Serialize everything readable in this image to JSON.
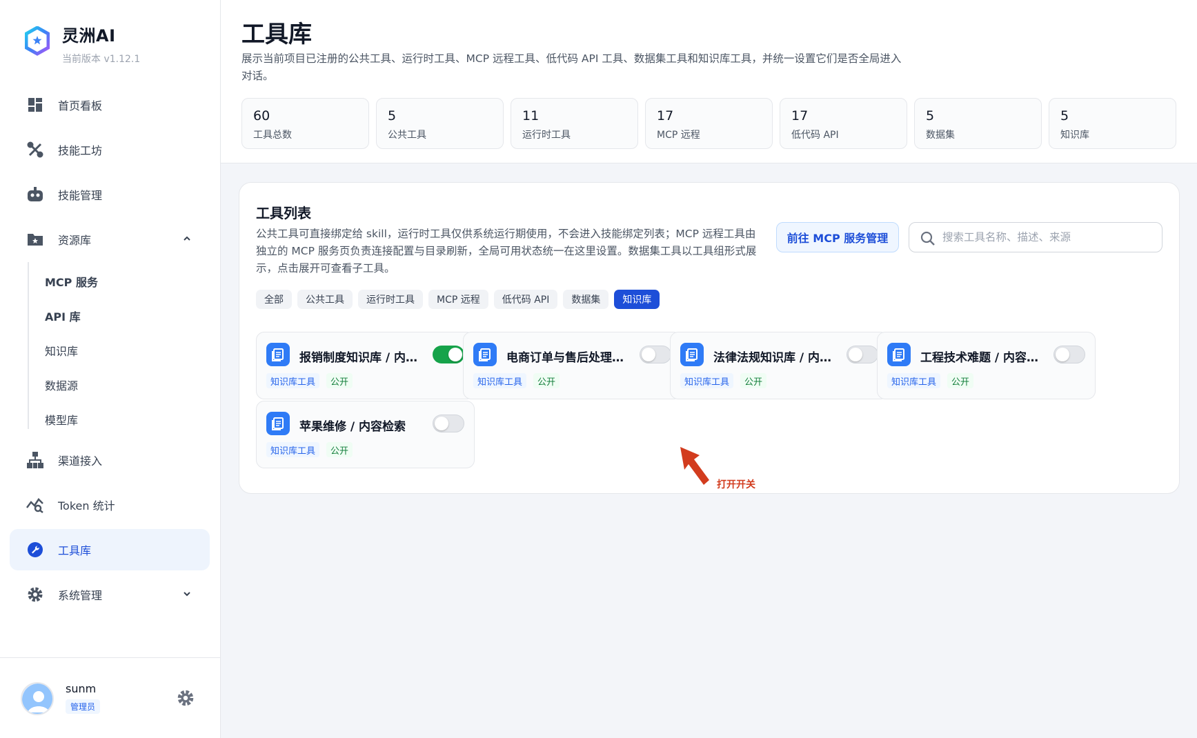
{
  "app": {
    "name": "灵洲AI",
    "version": "当前版本 v1.12.1"
  },
  "nav": {
    "home": "首页看板",
    "skill_workshop": "技能工坊",
    "skill_manage": "技能管理",
    "resources": "资源库",
    "resources_sub": [
      "MCP 服务",
      "API 库",
      "知识库",
      "数据源",
      "模型库"
    ],
    "channels": "渠道接入",
    "token_stats": "Token 统计",
    "tools": "工具库",
    "system": "系统管理"
  },
  "user": {
    "name": "sunm",
    "role": "管理员"
  },
  "page": {
    "title": "工具库",
    "description": "展示当前项目已注册的公共工具、运行时工具、MCP 远程工具、低代码 API 工具、数据集工具和知识库工具，并统一设置它们是否全局进入对话。"
  },
  "stats": [
    {
      "value": "60",
      "label": "工具总数"
    },
    {
      "value": "5",
      "label": "公共工具"
    },
    {
      "value": "11",
      "label": "运行时工具"
    },
    {
      "value": "17",
      "label": "MCP 远程"
    },
    {
      "value": "17",
      "label": "低代码 API"
    },
    {
      "value": "5",
      "label": "数据集"
    },
    {
      "value": "5",
      "label": "知识库"
    }
  ],
  "panel": {
    "title": "工具列表",
    "description": "公共工具可直接绑定给 skill，运行时工具仅供系统运行期使用，不会进入技能绑定列表；MCP 远程工具由独立的 MCP 服务页负责连接配置与目录刷新，全局可用状态统一在这里设置。数据集工具以工具组形式展示，点击展开可查看子工具。",
    "mcp_button": "前往 MCP 服务管理",
    "search_placeholder": "搜索工具名称、描述、来源"
  },
  "filters": [
    "全部",
    "公共工具",
    "运行时工具",
    "MCP 远程",
    "低代码 API",
    "数据集",
    "知识库"
  ],
  "active_filter": "知识库",
  "tools": [
    {
      "name": "报销制度知识库 / 内...",
      "tags": [
        "知识库工具",
        "公开"
      ],
      "enabled": true
    },
    {
      "name": "电商订单与售后处理...",
      "tags": [
        "知识库工具",
        "公开"
      ],
      "enabled": false
    },
    {
      "name": "法律法规知识库 / 内...",
      "tags": [
        "知识库工具",
        "公开"
      ],
      "enabled": false
    },
    {
      "name": "工程技术难题 / 内容...",
      "tags": [
        "知识库工具",
        "公开"
      ],
      "enabled": false
    },
    {
      "name": "苹果维修 / 内容检索",
      "tags": [
        "知识库工具",
        "公开"
      ],
      "enabled": false
    }
  ],
  "annotation": {
    "text": "打开开关"
  },
  "colors": {
    "accent": "#1d4ed8",
    "toggle_on": "#16a34a",
    "annotation": "#d23c1e"
  }
}
